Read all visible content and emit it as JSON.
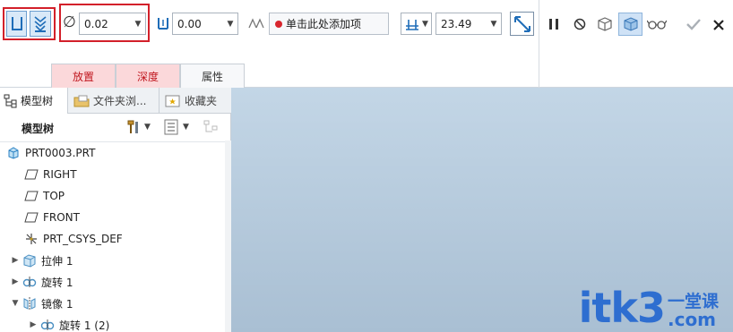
{
  "ribbon": {
    "diameter_value": "0.02",
    "depth_value": "0.00",
    "reference_prompt": "单击此处添加项",
    "offset_value": "23.49"
  },
  "tabs": [
    {
      "label": "放置"
    },
    {
      "label": "深度"
    },
    {
      "label": "属性"
    }
  ],
  "panel": {
    "tabs": [
      {
        "label": "模型树"
      },
      {
        "label": "文件夹浏..."
      },
      {
        "label": "收藏夹"
      }
    ],
    "title": "模型树"
  },
  "tree": [
    {
      "label": "PRT0003.PRT"
    },
    {
      "label": "RIGHT"
    },
    {
      "label": "TOP"
    },
    {
      "label": "FRONT"
    },
    {
      "label": "PRT_CSYS_DEF"
    },
    {
      "label": "拉伸 1"
    },
    {
      "label": "旋转 1"
    },
    {
      "label": "镜像 1"
    },
    {
      "label": "旋转 1 (2)"
    }
  ],
  "watermark": {
    "main": "itk3",
    "side_top": "一堂课",
    "side_bottom": ".com"
  },
  "colors": {
    "highlight_red": "#d3202a",
    "tab_red_bg": "#fbd8da",
    "viewport_top": "#c3d6e6",
    "viewport_bottom": "#a9bfd3",
    "watermark": "#2e6ed0"
  }
}
